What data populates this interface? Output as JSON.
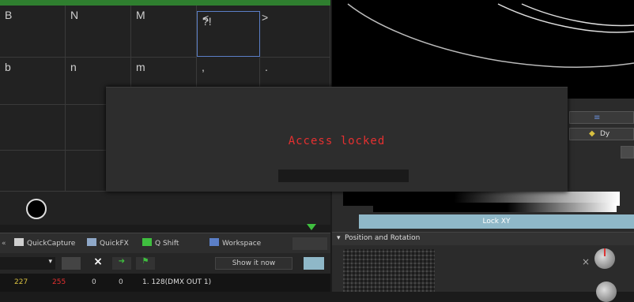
{
  "keyboard": {
    "row1": [
      "B",
      "N",
      "M",
      "<",
      "",
      ">"
    ],
    "row2": [
      "b",
      "n",
      "m",
      ",",
      "."
    ],
    "selected_key_badge": "?!"
  },
  "modal": {
    "message": "Access locked"
  },
  "tabs": {
    "items": [
      {
        "label": "QuickCapture",
        "icon": "capture-icon"
      },
      {
        "label": "QuickFX",
        "icon": "fx-icon"
      },
      {
        "label": "Q Shift",
        "icon": "shift-icon"
      },
      {
        "label": "Workspace",
        "icon": "workspace-icon"
      }
    ]
  },
  "toolbar": {
    "show_now_label": "Show it now"
  },
  "output_row": {
    "values": [
      "227",
      "255",
      "0",
      "0"
    ],
    "channel_label": "1. 128(DMX OUT 1)"
  },
  "right_panel": {
    "lock_xy_label": "Lock XY",
    "dyn_label": "Dy",
    "position_rotation_label": "Position and Rotation"
  },
  "colors": {
    "alert": "#e53030",
    "selection": "#5b7fc7",
    "accent_green": "#2fbf2f",
    "lockxy": "#8fb8c8"
  }
}
